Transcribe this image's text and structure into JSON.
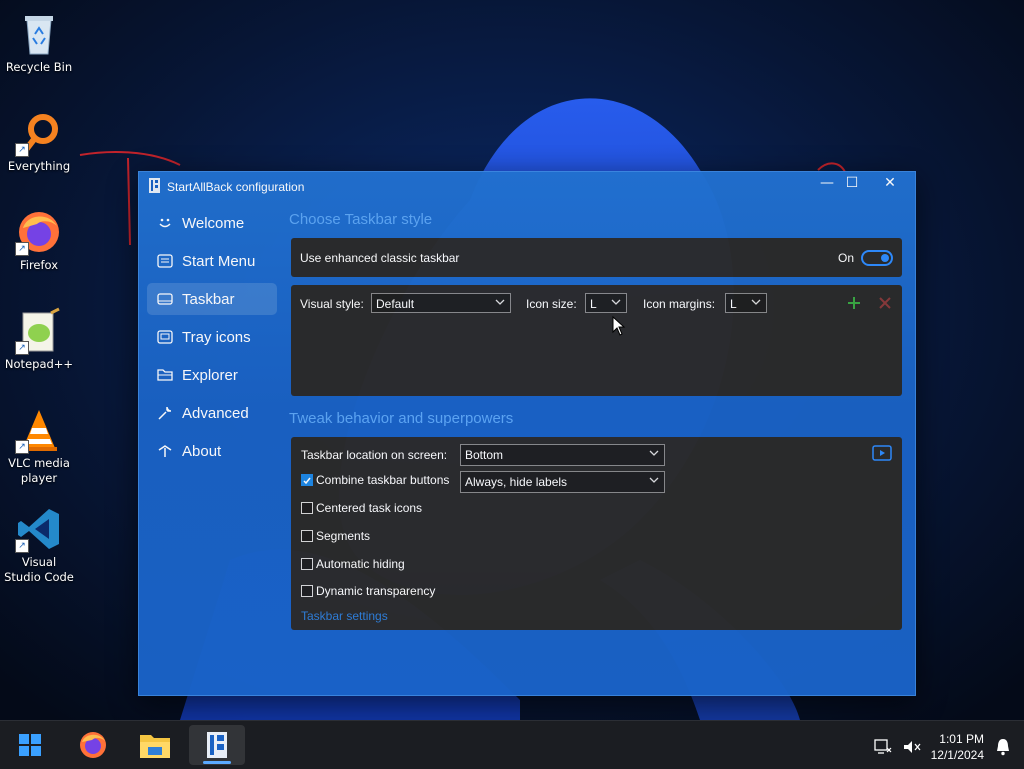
{
  "desktop": {
    "icons": [
      {
        "label": "Recycle Bin",
        "icon": "recycle-bin-icon"
      },
      {
        "label": "Everything",
        "icon": "everything-search-icon"
      },
      {
        "label": "Firefox",
        "icon": "firefox-icon"
      },
      {
        "label": "Notepad++",
        "icon": "notepad-plus-plus-icon"
      },
      {
        "label": "VLC media player",
        "icon": "vlc-icon"
      },
      {
        "label": "Visual Studio Code",
        "icon": "vscode-icon"
      }
    ]
  },
  "window": {
    "title": "StartAllBack configuration",
    "controls": {
      "minimize": "minimize-icon",
      "maximize": "maximize-icon",
      "close": "close-icon"
    }
  },
  "sidebar": {
    "items": [
      {
        "label": "Welcome",
        "icon": "smile-icon",
        "selected": false
      },
      {
        "label": "Start Menu",
        "icon": "start-menu-icon",
        "selected": false
      },
      {
        "label": "Taskbar",
        "icon": "taskbar-icon",
        "selected": true
      },
      {
        "label": "Tray icons",
        "icon": "tray-icon",
        "selected": false
      },
      {
        "label": "Explorer",
        "icon": "folder-icon",
        "selected": false
      },
      {
        "label": "Advanced",
        "icon": "wrench-icon",
        "selected": false
      },
      {
        "label": "About",
        "icon": "about-icon",
        "selected": false
      }
    ]
  },
  "style_section": {
    "title": "Choose Taskbar style",
    "enhanced_label": "Use enhanced classic taskbar",
    "enhanced_state": "On",
    "visual_style_label": "Visual style:",
    "visual_style_value": "Default",
    "icon_size_label": "Icon size:",
    "icon_size_value": "L",
    "icon_margins_label": "Icon margins:",
    "icon_margins_value": "L"
  },
  "behavior_section": {
    "title": "Tweak behavior and superpowers",
    "location_label": "Taskbar location on screen:",
    "location_value": "Bottom",
    "combine_label": "Combine taskbar buttons",
    "combine_value": "Always, hide labels",
    "options": [
      {
        "label": "Combine taskbar buttons",
        "checked": true
      },
      {
        "label": "Centered task icons",
        "checked": false
      },
      {
        "label": "Segments",
        "checked": false
      },
      {
        "label": "Automatic hiding",
        "checked": false
      },
      {
        "label": "Dynamic transparency",
        "checked": false
      }
    ],
    "link": "Taskbar settings"
  },
  "taskbar": {
    "apps": [
      "start-icon",
      "firefox-icon",
      "file-explorer-icon",
      "startallback-icon"
    ],
    "time": "1:01 PM",
    "date": "12/1/2024"
  },
  "colors": {
    "accent": "#2f8cff",
    "section_title": "#5ea7f5",
    "panel": "#2b2b2b",
    "window": "#1c66c8"
  }
}
